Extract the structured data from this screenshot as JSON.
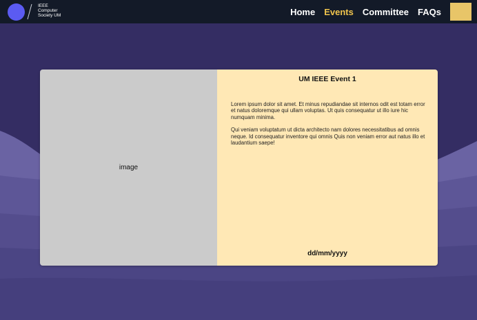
{
  "brand": {
    "lines": [
      "IEEE",
      "Computer",
      "Society UM"
    ]
  },
  "nav": {
    "items": [
      {
        "label": "Home",
        "active": false
      },
      {
        "label": "Events",
        "active": true
      },
      {
        "label": "Committee",
        "active": false
      },
      {
        "label": "FAQs",
        "active": false
      }
    ]
  },
  "event": {
    "image_placeholder": "image",
    "title": "UM IEEE Event 1",
    "description": [
      "Lorem ipsum dolor sit amet. Et minus repudiandae sit internos odit est  totam error et natus doloremque qui ullam voluptas. Ut quis consequatur  ut illo iure hic numquam minima.",
      "Qui veniam voluptatum ut dicta  architecto nam dolores necessitatibus ad omnis neque. Id consequatur  inventore qui omnis Quis non veniam error aut natus illo et laudantium  saepe!"
    ],
    "date": "dd/mm/yyyy"
  },
  "colors": {
    "navbar": "#131a28",
    "active_nav": "#f0c44d",
    "logo": "#5b5bf2",
    "card_body": "#ffe8b5",
    "image_placeholder": "#cbcbcb"
  }
}
